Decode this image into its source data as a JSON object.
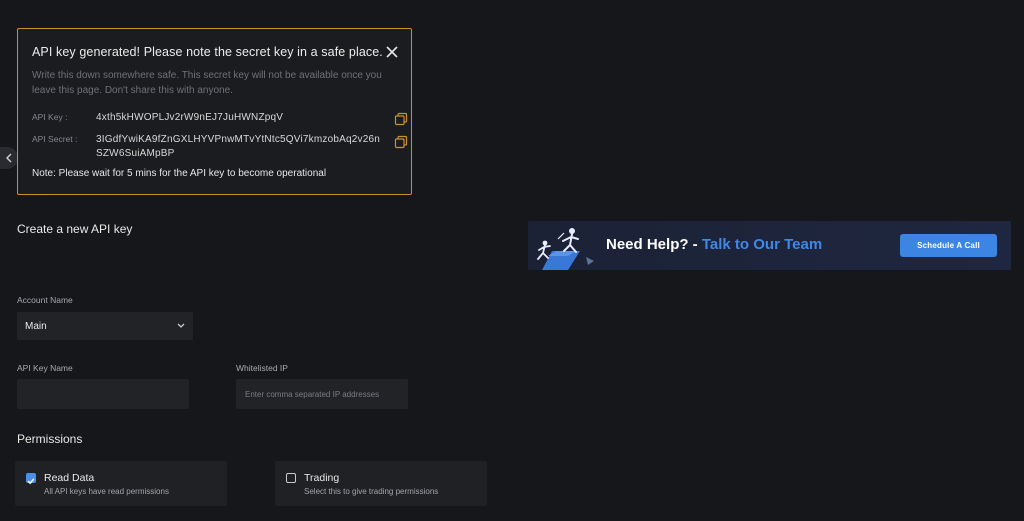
{
  "notice": {
    "title": "API key generated! Please note the secret key in a safe place.",
    "description": "Write this down somewhere safe. This secret key will not be available once you leave this page. Don't share this with anyone.",
    "api_key_label": "API Key :",
    "api_key_value": "4xth5kHWOPLJv2rW9nEJ7JuHWNZpqV",
    "api_secret_label": "API Secret :",
    "api_secret_value": "3IGdfYwiKA9fZnGXLHYVPnwMTvYtNtc5QVi7kmzobAq2v26nSZW6SuiAMpBP",
    "note": "Note: Please wait for 5 mins for the API key to become operational",
    "border_color": "#c9922e"
  },
  "form": {
    "section_title": "Create a new API key",
    "account_name_label": "Account Name",
    "account_name_value": "Main",
    "api_key_name_label": "API Key Name",
    "api_key_name_value": "",
    "whitelisted_ip_label": "Whitelisted IP",
    "whitelisted_ip_placeholder": "Enter comma separated IP addresses"
  },
  "help_banner": {
    "lead": "Need Help? -",
    "accent": "Talk to Our Team",
    "button_label": "Schedule A Call",
    "accent_color": "#3f88e8"
  },
  "permissions": {
    "title": "Permissions",
    "items": [
      {
        "name": "Read Data",
        "description": "All API keys have read permissions",
        "checked": true
      },
      {
        "name": "Trading",
        "description": "Select this to give trading permissions",
        "checked": false
      }
    ]
  }
}
